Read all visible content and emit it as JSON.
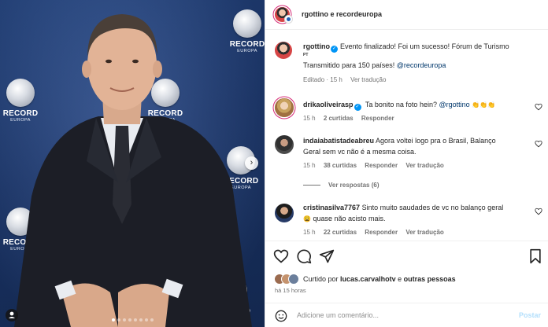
{
  "photo": {
    "brand_logo": "RECORD",
    "brand_sub": "EUROPA",
    "carousel_slide_count": 8,
    "carousel_active_index": 0
  },
  "header": {
    "title": "rgottino e recordeuropa"
  },
  "caption": {
    "username": "rgottino",
    "text_line1": "Evento finalizado! Foi um sucesso! Fórum de Turismo",
    "flag": "PT",
    "text_line2_prefix": "Transmitido para 150 países!",
    "mention": "@recordeuropa",
    "edited": "Editado",
    "age": "15 h",
    "see_translation": "Ver tradução"
  },
  "comments": [
    {
      "username": "drikaoliveirasp",
      "verified": true,
      "line1": "Ta bonito na foto hein?",
      "mention": "@rgottino",
      "emoji": "👏👏👏",
      "age": "15 h",
      "likes": "2 curtidas",
      "reply": "Responder"
    },
    {
      "username": "indaiabatistadeabreu",
      "line1": "Agora voltei logo pra o Brasil, Balanço",
      "line2": "Geral sem vc não é a mesma coisa.",
      "age": "15 h",
      "likes": "38 curtidas",
      "reply": "Responder",
      "see_translation": "Ver tradução",
      "view_replies": "Ver respostas (6)"
    },
    {
      "username": "cristinasilva7767",
      "line1": "Sinto muito saudades de vc no balanço geral",
      "line2": "quase não acisto mais.",
      "emoji": "😩",
      "age": "15 h",
      "likes": "22 curtidas",
      "reply": "Responder",
      "see_translation": "Ver tradução"
    }
  ],
  "actions": {
    "liked_by_prefix": "Curtido por",
    "liked_by_user": "lucas.carvalhotv",
    "liked_by_joiner": "e",
    "liked_by_others": "outras pessoas",
    "time_ago": "há 15 horas",
    "icons": [
      "heart-icon",
      "comment-icon",
      "share-icon",
      "save-icon"
    ]
  },
  "comment_input": {
    "emoji_icon": "smiley-icon",
    "placeholder": "Adicione um comentário...",
    "post_label": "Postar"
  },
  "colors": {
    "verified": "#0095f6",
    "mention": "#00376b",
    "secondary_text": "#737373",
    "post_disabled": "#b2dffc",
    "photo_background": "#234a8c"
  }
}
